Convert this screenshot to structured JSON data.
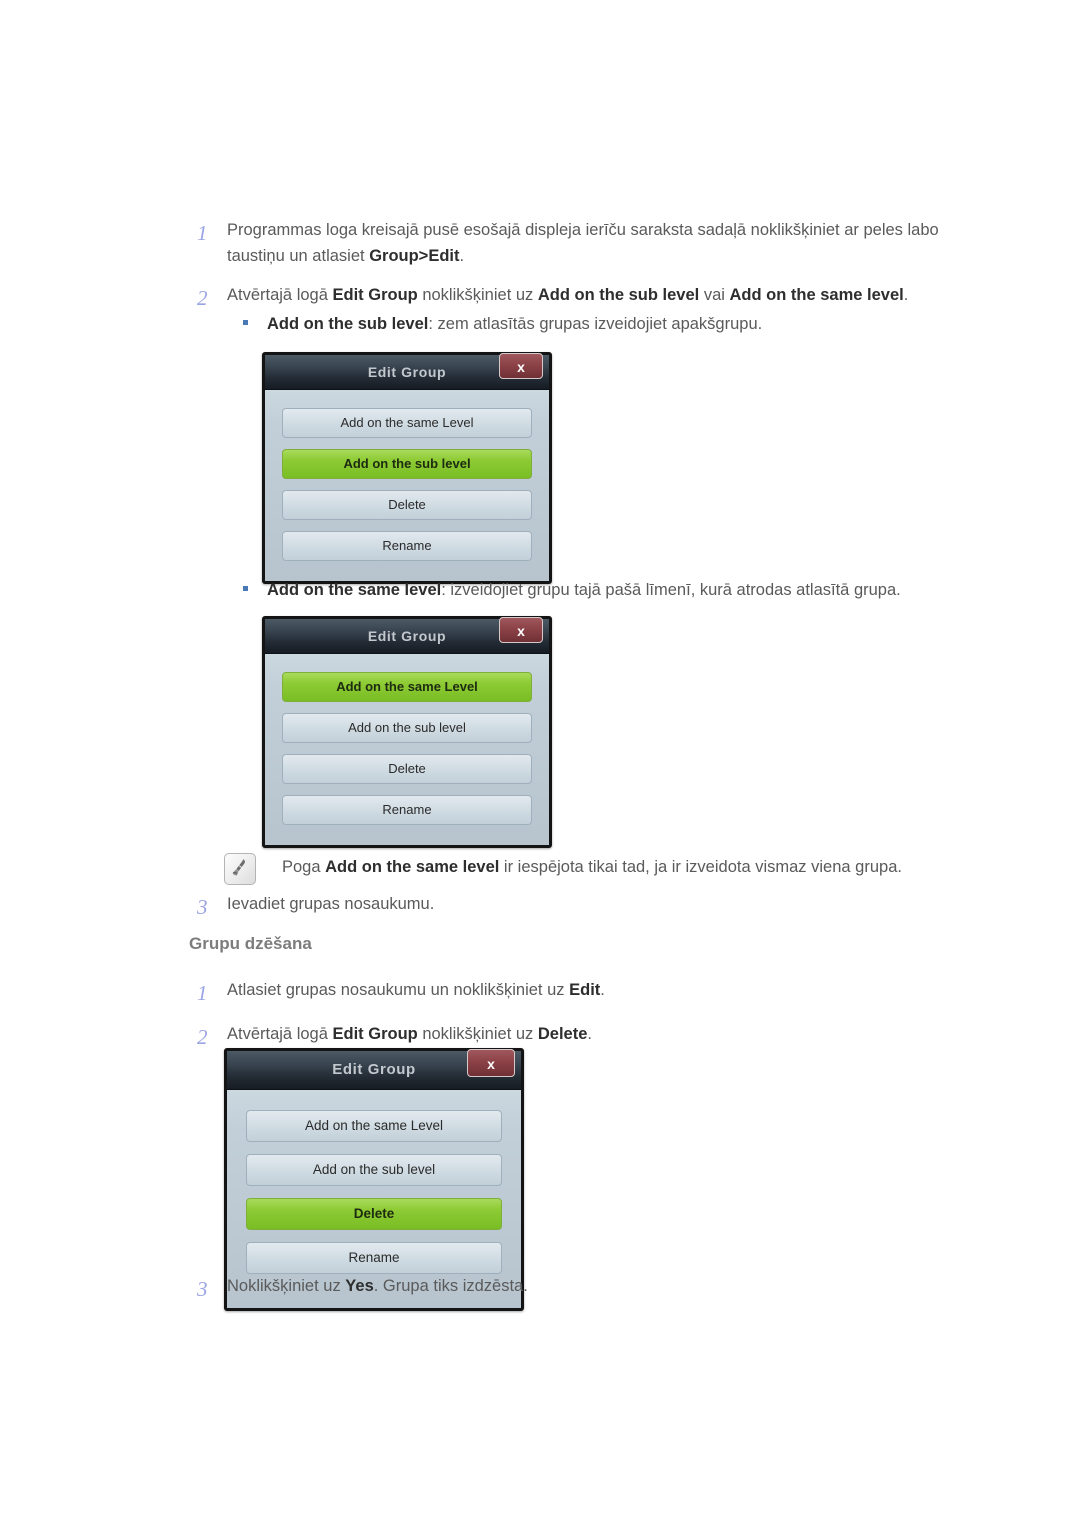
{
  "steps_add": [
    {
      "num": "1",
      "parts": [
        {
          "t": "Programmas loga kreisajā pusē esošajā displeja ierīču saraksta sadaļā noklikšķiniet ar peles labo taustiņu un atlasiet ",
          "b": false
        },
        {
          "t": "Group>Edit",
          "b": true
        },
        {
          "t": ".",
          "b": false
        }
      ]
    },
    {
      "num": "2",
      "parts": [
        {
          "t": "Atvērtajā logā ",
          "b": false
        },
        {
          "t": "Edit Group",
          "b": true
        },
        {
          "t": " noklikšķiniet uz ",
          "b": false
        },
        {
          "t": "Add on the sub level",
          "b": true
        },
        {
          "t": " vai ",
          "b": false
        },
        {
          "t": "Add on the same level",
          "b": true
        },
        {
          "t": ".",
          "b": false
        }
      ]
    }
  ],
  "bullet_sub": {
    "marker": "square-bullet",
    "parts": [
      {
        "t": "Add on the sub level",
        "b": true
      },
      {
        "t": ": zem atlasītās grupas izveidojiet apakšgrupu.",
        "b": false
      }
    ]
  },
  "bullet_same": {
    "marker": "square-bullet",
    "parts": [
      {
        "t": "Add on the same level",
        "b": true
      },
      {
        "t": ": izveidojiet grupu tajā pašā līmenī, kurā atrodas atlasītā grupa.",
        "b": false
      }
    ]
  },
  "note": {
    "icon": "note-hand-icon",
    "parts": [
      {
        "t": "Poga ",
        "b": false
      },
      {
        "t": "Add on the same level",
        "b": true
      },
      {
        "t": " ir iespējota tikai tad, ja ir izveidota vismaz viena grupa.",
        "b": false
      }
    ]
  },
  "step3_add": {
    "num": "3",
    "parts": [
      {
        "t": "Ievadiet grupas nosaukumu.",
        "b": false
      }
    ]
  },
  "section_heading": "Grupu dzēšana",
  "steps_delete": [
    {
      "num": "1",
      "parts": [
        {
          "t": "Atlasiet grupas nosaukumu un noklikšķiniet uz ",
          "b": false
        },
        {
          "t": "Edit",
          "b": true
        },
        {
          "t": ".",
          "b": false
        }
      ]
    },
    {
      "num": "2",
      "parts": [
        {
          "t": "Atvērtajā logā ",
          "b": false
        },
        {
          "t": "Edit Group",
          "b": true
        },
        {
          "t": " noklikšķiniet uz ",
          "b": false
        },
        {
          "t": "Delete",
          "b": true
        },
        {
          "t": ".",
          "b": false
        }
      ]
    }
  ],
  "step3_delete": {
    "num": "3",
    "parts": [
      {
        "t": "Noklikšķiniet uz ",
        "b": false
      },
      {
        "t": "Yes",
        "b": true
      },
      {
        "t": ". Grupa tiks izdzēsta.",
        "b": false
      }
    ]
  },
  "dialogs": [
    {
      "id": "dialog-sub-level",
      "title": "Edit Group",
      "close_label": "x",
      "buttons": [
        {
          "label": "Add on the same Level",
          "selected": false
        },
        {
          "label": "Add on the sub level",
          "selected": true
        },
        {
          "label": "Delete",
          "selected": false
        },
        {
          "label": "Rename",
          "selected": false
        }
      ]
    },
    {
      "id": "dialog-same-level",
      "title": "Edit Group",
      "close_label": "x",
      "buttons": [
        {
          "label": "Add on the same Level",
          "selected": true
        },
        {
          "label": "Add on the sub level",
          "selected": false
        },
        {
          "label": "Delete",
          "selected": false
        },
        {
          "label": "Rename",
          "selected": false
        }
      ]
    },
    {
      "id": "dialog-delete",
      "title": "Edit Group",
      "close_label": "x",
      "buttons": [
        {
          "label": "Add on the same Level",
          "selected": false
        },
        {
          "label": "Add on the sub level",
          "selected": false
        },
        {
          "label": "Delete",
          "selected": true
        },
        {
          "label": "Rename",
          "selected": false
        }
      ]
    }
  ],
  "colors": {
    "step_number": "#9ba4e2",
    "bullet": "#4a7ab5",
    "body_text": "#5a5a5a",
    "bold_text": "#2e2e2e",
    "heading": "#7d7d7d",
    "selected_button": "#8ecb35",
    "dialog_titlebar": "#222a33",
    "close_button": "#8c4247",
    "dialog_body": "#c2cfd8"
  }
}
